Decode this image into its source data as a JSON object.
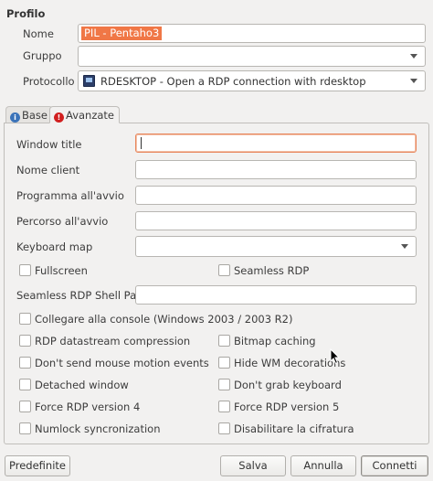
{
  "profile": {
    "title": "Profilo",
    "name_label": "Nome",
    "name_value": "PIL - Pentaho3",
    "group_label": "Gruppo",
    "group_value": "",
    "protocol_label": "Protocollo",
    "protocol_value": "RDESKTOP - Open a RDP connection with rdesktop"
  },
  "tabs": [
    {
      "label": "Base",
      "icon": "info-icon"
    },
    {
      "label": "Avanzate",
      "icon": "warning-icon"
    }
  ],
  "advanced": {
    "window_title_label": "Window title",
    "client_name_label": "Nome client",
    "startup_program_label": "Programma all'avvio",
    "startup_path_label": "Percorso all'avvio",
    "keyboard_map_label": "Keyboard map",
    "shell_path_label": "Seamless RDP Shell Path",
    "checkboxes": {
      "fullscreen": "Fullscreen",
      "seamless_rdp": "Seamless RDP",
      "console": "Collegare alla console (Windows 2003 / 2003 R2)",
      "datastream": "RDP datastream compression",
      "bitmap_caching": "Bitmap caching",
      "no_mouse_motion": "Don't send mouse motion events",
      "hide_wm": "Hide WM decorations",
      "detached": "Detached window",
      "no_grab_kbd": "Don't grab keyboard",
      "rdp4": "Force RDP version 4",
      "rdp5": "Force RDP version 5",
      "numlock": "Numlock syncronization",
      "disable_encryption": "Disabilitare la cifratura"
    }
  },
  "buttons": {
    "defaults": "Predefinite",
    "save": "Salva",
    "cancel": "Annulla",
    "connect": "Connetti"
  },
  "colors": {
    "selection": "#f07746",
    "focus_border": "#e8865c",
    "info_icon": "#3b73b9",
    "warning_icon": "#d11f1f"
  }
}
